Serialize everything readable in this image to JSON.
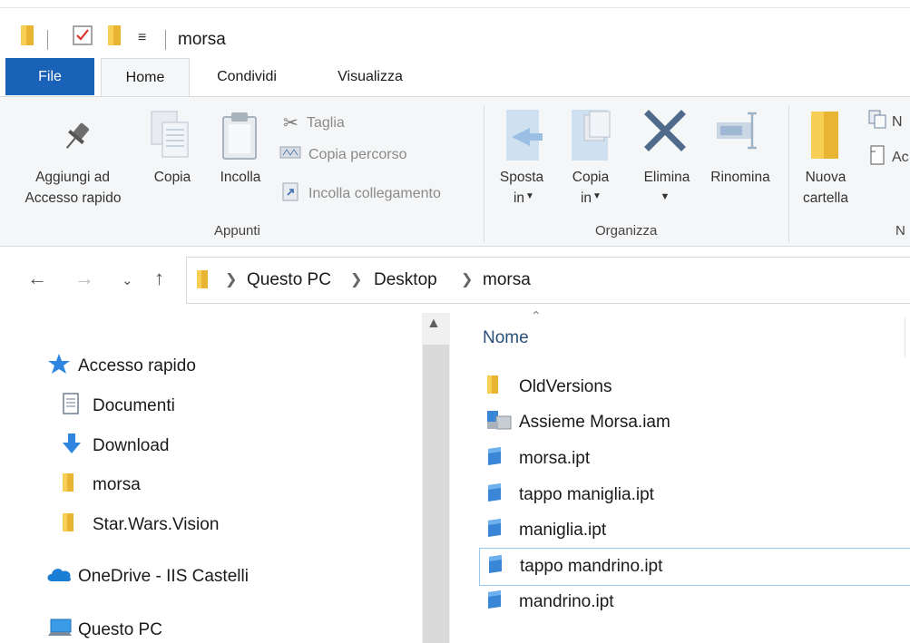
{
  "window": {
    "title": "morsa"
  },
  "tabs": [
    {
      "label": "File"
    },
    {
      "label": "Home"
    },
    {
      "label": "Condividi"
    },
    {
      "label": "Visualizza"
    }
  ],
  "ribbon": {
    "pin": {
      "line1": "Aggiungi ad",
      "line2": "Accesso rapido"
    },
    "copy": "Copia",
    "paste": "Incolla",
    "cut": "Taglia",
    "copy_path": "Copia percorso",
    "paste_shortcut": "Incolla collegamento",
    "group_clipboard": "Appunti",
    "move_to": {
      "line1": "Sposta",
      "line2": "in"
    },
    "copy_to": {
      "line1": "Copia",
      "line2": "in"
    },
    "delete": "Elimina",
    "rename": "Rinomina",
    "group_organize": "Organizza",
    "new_folder": {
      "line1": "Nuova",
      "line2": "cartella"
    },
    "new_item_partial": "N",
    "easy_access_partial": "Ac",
    "group_new_partial": "N"
  },
  "address": {
    "crumbs": [
      "Questo PC",
      "Desktop",
      "morsa"
    ]
  },
  "nav_pane": {
    "items": [
      {
        "label": "Accesso rapido",
        "icon": "star-icon"
      },
      {
        "label": "Documenti",
        "icon": "document-icon"
      },
      {
        "label": "Download",
        "icon": "download-arrow-icon"
      },
      {
        "label": "morsa",
        "icon": "folder-icon"
      },
      {
        "label": "Star.Wars.Vision",
        "icon": "folder-icon"
      },
      {
        "label": "OneDrive - IIS Castelli",
        "icon": "cloud-icon"
      },
      {
        "label": "Questo PC",
        "icon": "computer-icon"
      }
    ]
  },
  "file_list": {
    "column_name": "Nome",
    "rows": [
      {
        "name": "OldVersions",
        "icon": "folder-icon"
      },
      {
        "name": "Assieme Morsa.iam",
        "icon": "assembly-file-icon"
      },
      {
        "name": "morsa.ipt",
        "icon": "part-file-icon"
      },
      {
        "name": "tappo maniglia.ipt",
        "icon": "part-file-icon"
      },
      {
        "name": "maniglia.ipt",
        "icon": "part-file-icon"
      },
      {
        "name": "tappo mandrino.ipt",
        "icon": "part-file-icon",
        "selected": true
      },
      {
        "name": "mandrino.ipt",
        "icon": "part-file-icon"
      }
    ]
  },
  "colors": {
    "file_tab": "#1a62b8",
    "folder": "#f4c343",
    "part_blue": "#3a86d6",
    "accent_blue": "#1e6fd1",
    "selection_border": "#99c9ef"
  }
}
